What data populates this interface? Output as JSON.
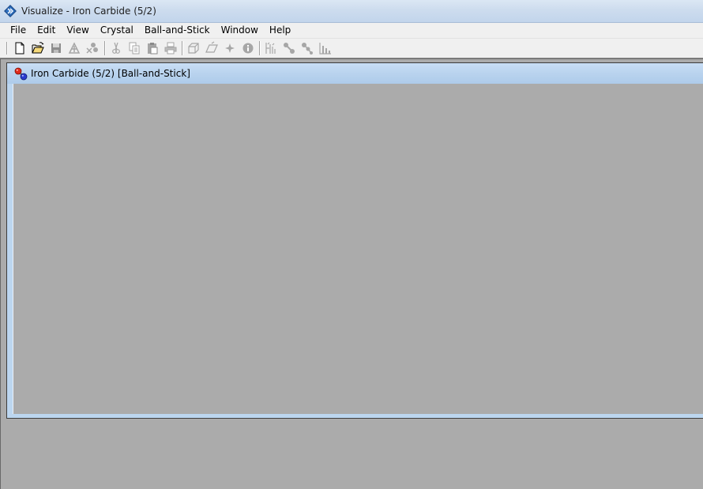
{
  "window": {
    "title": "Visualize - Iron Carbide (5/2)"
  },
  "menu": {
    "items": [
      "File",
      "Edit",
      "View",
      "Crystal",
      "Ball-and-Stick",
      "Window",
      "Help"
    ]
  },
  "toolbar": {
    "buttons": [
      {
        "name": "new-icon",
        "enabled": true
      },
      {
        "name": "open-icon",
        "enabled": true
      },
      {
        "name": "save-icon",
        "enabled": false
      },
      {
        "name": "build-icon",
        "enabled": false
      },
      {
        "name": "delete-atoms-icon",
        "enabled": false
      },
      {
        "name": "cut-icon",
        "enabled": false
      },
      {
        "name": "copy-icon",
        "enabled": false
      },
      {
        "name": "paste-icon",
        "enabled": false
      },
      {
        "name": "print-icon",
        "enabled": false
      },
      {
        "name": "cell-icon",
        "enabled": false
      },
      {
        "name": "plane-icon",
        "enabled": false
      },
      {
        "name": "star-icon",
        "enabled": false
      },
      {
        "name": "info-icon",
        "enabled": false
      },
      {
        "name": "measure-icon",
        "enabled": false
      },
      {
        "name": "bond-icon",
        "enabled": false
      },
      {
        "name": "angle-icon",
        "enabled": false
      },
      {
        "name": "histogram-icon",
        "enabled": false
      }
    ]
  },
  "child_window": {
    "title": "Iron Carbide (5/2) [Ball-and-Stick]"
  },
  "colors": {
    "workspace": "#ababab",
    "child_frame": "#bcd6ef",
    "disabled_icon": "#a6a6a6"
  }
}
